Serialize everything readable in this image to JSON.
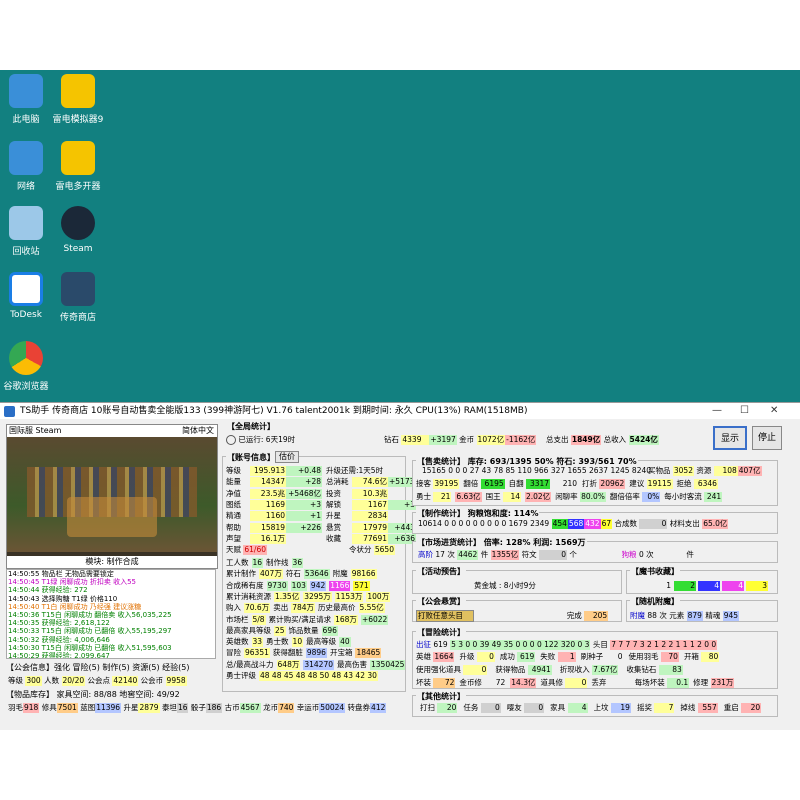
{
  "desktop": [
    {
      "label": "此电脑",
      "icon": "computer-icon"
    },
    {
      "label": "雷电模拟器9",
      "icon": "emulator-icon"
    },
    {
      "label": "网络",
      "icon": "network-icon"
    },
    {
      "label": "雷电多开器",
      "icon": "multi-open-icon"
    },
    {
      "label": "回收站",
      "icon": "recycle-bin-icon"
    },
    {
      "label": "Steam",
      "icon": "steam-icon"
    },
    {
      "label": "ToDesk",
      "icon": "todesk-icon"
    },
    {
      "label": "传奇商店",
      "icon": "game-shop-icon"
    },
    {
      "label": "谷歌浏览器",
      "icon": "chrome-icon"
    }
  ],
  "window": {
    "title": "TS助手 传奇商店 10账号自动售卖全能版133 (399神游阿七) V1.76 talent2001k 到期时间: 永久 CPU(13%) RAM(1518MB)",
    "min": "—",
    "max": "☐",
    "close": "✕"
  },
  "game": {
    "server": "国际服 Steam",
    "lang": "简体中文",
    "module": "模块: 制作合成"
  },
  "log": [
    {
      "t": "14:50:55 物品栏 无物品需要锁定",
      "c": "#000"
    },
    {
      "t": "14:50:45 T1绿 闲聊成功 折扣卖 收入55",
      "c": "#c000c0"
    },
    {
      "t": "14:50:44 获得经验: 272",
      "c": "#008000"
    },
    {
      "t": "14:50:43 选择购糖 T1绿 价格110",
      "c": "#000"
    },
    {
      "t": "14:50:40 T1白 闲聊成功 乃经强 建议涨糖",
      "c": "#e07000"
    },
    {
      "t": "14:50:36 T15白 闲聊成功 翻倍卖 收入56,035,225",
      "c": "#008000"
    },
    {
      "t": "14:50:35 获得经验: 2,618,122",
      "c": "#008000"
    },
    {
      "t": "14:50:33 T15白 闲聊成功 已翻倍 收入55,195,297",
      "c": "#008000"
    },
    {
      "t": "14:50:32 获得经验: 4,006,646",
      "c": "#008000"
    },
    {
      "t": "14:50:30 T15白 闲聊成功 已翻倍 收入51,595,603",
      "c": "#008000"
    },
    {
      "t": "14:50:29 获得经验: 2,099,647",
      "c": "#008000"
    }
  ],
  "guild": {
    "title": "【公会信息】强化 冒险(5) 制作(5) 资源(5) 经验(5)",
    "level_l": "等级",
    "level": "300",
    "members_l": "人数",
    "members": "20/20",
    "pts_l": "公会点",
    "pts": "42140",
    "coin_l": "公会币",
    "coin": "9958"
  },
  "inventory": {
    "title": "【物品库存】 家具空间: 88/88 地窖空间: 49/92",
    "items": [
      [
        "羽毛",
        "918"
      ],
      [
        "修具",
        "7501"
      ],
      [
        "蓝图",
        "11396"
      ],
      [
        "升星",
        "2879"
      ],
      [
        "泰坦",
        "16"
      ],
      [
        "骰子",
        "186"
      ],
      [
        "古币",
        "4567"
      ],
      [
        "龙币",
        "740"
      ],
      [
        "幸运币",
        "50024"
      ],
      [
        "转盘券",
        "412"
      ]
    ]
  },
  "global": {
    "title": "【全局统计】",
    "runtime": "已运行: 6天19时",
    "diamond_l": "钻石",
    "diamond": "4339",
    "diamond_d": "+3197",
    "gold_l": "金币",
    "gold": "1072亿",
    "gold_d": "-1162亿",
    "spend_l": "总支出",
    "spend": "1849亿",
    "income_l": "总收入",
    "income": "5424亿",
    "btn_show": "显示",
    "btn_stop": "停止"
  },
  "account": {
    "title": "【账号信息】",
    "tab": "估价",
    "rows": [
      [
        "等级",
        "195.913",
        "+0.48",
        "升级还需:1天5时",
        "",
        ""
      ],
      [
        "能量",
        "14347",
        "+28",
        "总消耗",
        "74.6亿",
        "+5173万"
      ],
      [
        "净值",
        "23.5兆",
        "+5468亿",
        "投资",
        "10.3兆",
        ""
      ],
      [
        "图纸",
        "1169",
        "+3",
        "解锁",
        "1167",
        "+3"
      ],
      [
        "精通",
        "1160",
        "+1",
        "升星",
        "2834",
        ""
      ],
      [
        "帮助",
        "15819",
        "+226",
        "悬赏",
        "17979",
        "+443"
      ],
      [
        "声望",
        "16.1万",
        "",
        "收藏",
        "77691",
        "+636"
      ]
    ],
    "tianfu_l": "天赋",
    "tianfu": "61/60",
    "lingzhuang_l": "令状分",
    "lingzhuang": "5650",
    "grid": [
      [
        "工人数",
        "16",
        "制作线",
        "36",
        "",
        ""
      ],
      [
        "累计制作",
        "407万",
        "符石",
        "53646",
        "附魔",
        "98166"
      ],
      [
        "合成稀有度",
        "9730",
        "103",
        "942",
        "1166",
        "571"
      ],
      [
        "累计消耗资源",
        "1.35亿",
        "3295万",
        "1153万",
        "100万",
        ""
      ],
      [
        "购入",
        "70.6万",
        "卖出",
        "784万",
        "历史最高价",
        "5.55亿"
      ],
      [
        "市场栏",
        "5/8",
        "累计购买/满足请求",
        "168万",
        "+6022",
        ""
      ],
      [
        "最高家具等级",
        "25",
        "饰品数量",
        "696",
        "",
        ""
      ],
      [
        "英雄数",
        "33",
        "勇士数",
        "10",
        "最高等级",
        "40"
      ],
      [
        "冒险",
        "96351",
        "获得翻脏",
        "9896",
        "开宝箱",
        "18465"
      ],
      [
        "总/最高战斗力",
        "648万",
        "314270",
        "最高伤害",
        "1350425",
        ""
      ],
      [
        "勇士评级",
        "48 48 45 48 48 50 48 43 42 30",
        "",
        "",
        "",
        ""
      ]
    ]
  },
  "sell": {
    "title": "【售卖统计】 库存: 693/1395 50% 符石: 393/561 70%",
    "nums": "15165 0 0 0 27 43 78 85 110 966 327 1655 2637 1245 8240",
    "buy_l": "买物品",
    "buy": "3052",
    "res_l": "资源",
    "res": "108",
    "res_v": "407亿",
    "r2": [
      [
        "接客",
        "39195"
      ],
      [
        "翻倍",
        "6195"
      ],
      [
        "自翻",
        "3317"
      ],
      [
        "",
        "210"
      ],
      [
        "打折",
        "20962"
      ],
      [
        "建议",
        "19115"
      ],
      [
        "拒绝",
        "6346"
      ]
    ],
    "r3": [
      [
        "勇士",
        "21"
      ],
      [
        "",
        "6.63亿"
      ],
      [
        "国王",
        "14"
      ],
      [
        "",
        "2.02亿"
      ],
      [
        "闲聊率",
        "80.0%"
      ],
      [
        "翻倍倍率",
        "0%"
      ],
      [
        "每小时客流",
        "241"
      ]
    ]
  },
  "craft": {
    "title": "【制作统计】 狗粮饱和度: 114%",
    "nums": "10614 0 0 0 0 0 0 0 0 0 1679 2349",
    "c1": "454",
    "c2": "568",
    "c3": "432",
    "c4": "67",
    "hc_l": "合成数",
    "hc": "0",
    "mat_l": "材料支出",
    "mat": "65.0亿"
  },
  "market": {
    "title": "【市场进货统计】 倍率: 128% 利润: 1569万",
    "high_l": "高阶",
    "high": "17",
    "cnt_l": "次",
    "v1": "4462",
    "jian": "件",
    "v2": "1355亿",
    "fw_l": "符文",
    "fw": "0",
    "dog_l": "狗粮",
    "dog": "0",
    "jian2": "件"
  },
  "activity": {
    "title": "【活动预告】",
    "text": "黄金城 : 8小时9分"
  },
  "reward": {
    "title": "【公会悬赏】",
    "task": "打败任意头目",
    "done_l": "完成",
    "done": "205"
  },
  "magic": {
    "title": "【魔书收藏】",
    "vals": [
      "1",
      "2",
      "4",
      "4",
      "3"
    ]
  },
  "random": {
    "title": "【随机附魔】",
    "a_l": "附魔",
    "a": "88",
    "ci": "次",
    "y_l": "元素",
    "y": "879",
    "j_l": "精魂",
    "j": "945"
  },
  "adv": {
    "title": "【冒险统计】",
    "r1": [
      "出征",
      "619",
      "5 3 0 0 39 49 35 0 0 0 0 122 320 0 3",
      "头目",
      "7 7 7 7 3 2 1 2 2 1 1 1 2 0 0"
    ],
    "r2": [
      [
        "英雄",
        "1664"
      ],
      [
        "升级",
        "0"
      ],
      [
        "成功",
        "619"
      ],
      [
        "失败",
        "1"
      ],
      [
        "刷种子",
        "0"
      ],
      [
        "使用羽毛",
        "70"
      ],
      [
        "开箱",
        "80"
      ]
    ],
    "r3": [
      [
        "使用强化道具",
        "0"
      ],
      [
        "获得物品",
        "4941"
      ],
      [
        "折现收入",
        "7.67亿"
      ],
      [
        "收集钻石",
        "83"
      ]
    ],
    "r4": [
      [
        "坏装",
        "72"
      ],
      [
        "金币修",
        "72"
      ],
      [
        "",
        "14.3亿"
      ],
      [
        "道具修",
        "0"
      ],
      [
        "丢弃",
        ""
      ],
      [
        "每场坏装",
        "0.1"
      ],
      [
        "修理",
        "231万"
      ]
    ]
  },
  "other": {
    "title": "【其他统计】",
    "items": [
      [
        "打扫",
        "20"
      ],
      [
        "任务",
        "0"
      ],
      [
        "嘤友",
        "0"
      ],
      [
        "家具",
        "4"
      ],
      [
        "上坟",
        "19"
      ],
      [
        "摇奖",
        "7"
      ],
      [
        "掉线",
        "557"
      ],
      [
        "重启",
        "20"
      ]
    ]
  }
}
